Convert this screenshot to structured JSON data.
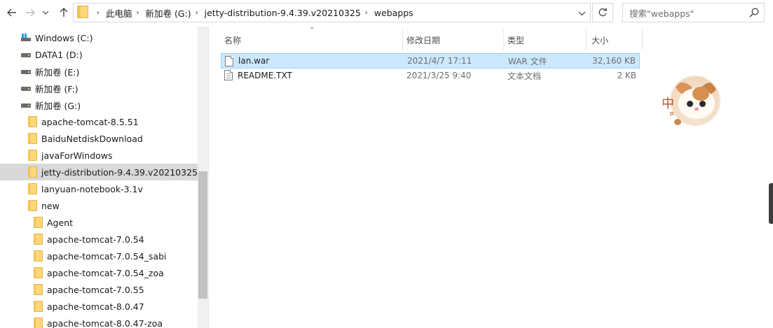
{
  "address_bar": {
    "breadcrumbs": [
      "此电脑",
      "新加卷 (G:)",
      "jetty-distribution-9.4.39.v20210325",
      "webapps"
    ]
  },
  "search": {
    "placeholder": "搜索\"webapps\""
  },
  "nav_pane": {
    "items": [
      {
        "label": "Windows (C:)",
        "kind": "os-drive"
      },
      {
        "label": "DATA1 (D:)",
        "kind": "drive"
      },
      {
        "label": "新加卷 (E:)",
        "kind": "drive"
      },
      {
        "label": "新加卷 (F:)",
        "kind": "drive"
      },
      {
        "label": "新加卷 (G:)",
        "kind": "drive"
      },
      {
        "label": "apache-tomcat-8.5.51",
        "kind": "folder"
      },
      {
        "label": "BaiduNetdiskDownload",
        "kind": "folder"
      },
      {
        "label": "javaForWindows",
        "kind": "folder"
      },
      {
        "label": "jetty-distribution-9.4.39.v20210325",
        "kind": "folder",
        "selected": true
      },
      {
        "label": "lanyuan-notebook-3.1v",
        "kind": "folder"
      },
      {
        "label": "new",
        "kind": "folder"
      },
      {
        "label": "Agent",
        "kind": "folder"
      },
      {
        "label": "apache-tomcat-7.0.54",
        "kind": "folder"
      },
      {
        "label": "apache-tomcat-7.0.54_sabi",
        "kind": "folder"
      },
      {
        "label": "apache-tomcat-7.0.54_zoa",
        "kind": "folder"
      },
      {
        "label": "apache-tomcat-7.0.55",
        "kind": "folder"
      },
      {
        "label": "apache-tomcat-8.0.47",
        "kind": "folder"
      },
      {
        "label": "apache-tomcat-8.0.47-zoa",
        "kind": "folder"
      }
    ]
  },
  "file_list": {
    "columns": {
      "name": "名称",
      "date": "修改日期",
      "type": "类型",
      "size": "大小"
    },
    "rows": [
      {
        "name": "lan.war",
        "date": "2021/4/7 17:11",
        "type": "WAR 文件",
        "size": "32,160 KB",
        "selected": true
      },
      {
        "name": "README.TXT",
        "date": "2021/3/25 9:40",
        "type": "文本文档",
        "size": "2 KB",
        "selected": false
      }
    ]
  },
  "ime_indicator": {
    "mode_label": "中"
  },
  "colors": {
    "selection_fill": "#cce8ff",
    "selection_border": "#99d1ff",
    "nav_selected": "#d9d9d9",
    "folder_yellow": "#ffd77a"
  }
}
